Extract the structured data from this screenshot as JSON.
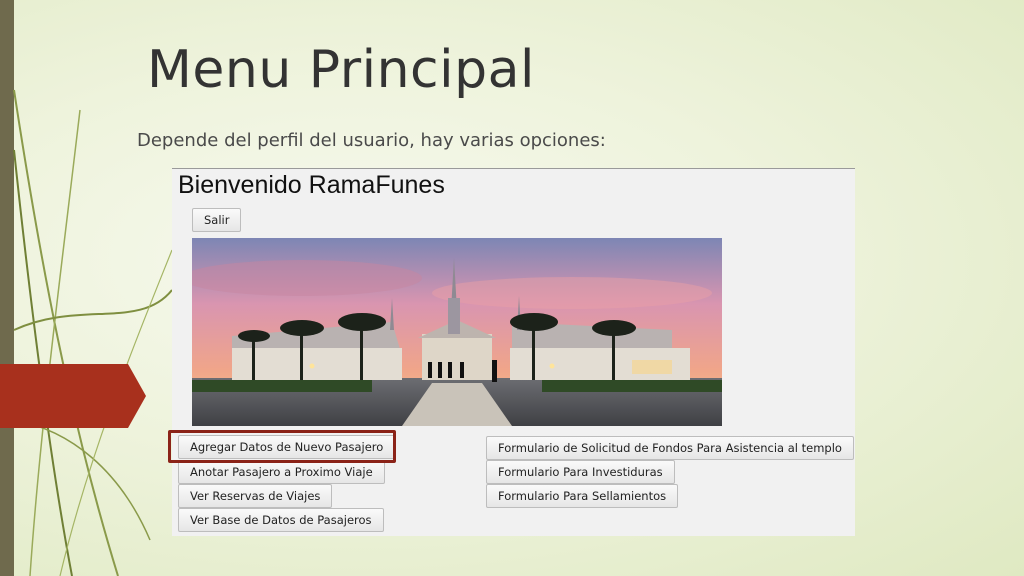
{
  "slide": {
    "title": "Menu Principal",
    "subtitle": "Depende del perfil del usuario, hay varias opciones:"
  },
  "app": {
    "welcome": "Bienvenido RamaFunes",
    "logout_label": "Salir",
    "image_description_icon": "temple-photo",
    "left_column": [
      "Agregar Datos de Nuevo Pasajero",
      "Anotar Pasajero a Proximo Viaje",
      "Ver Reservas de Viajes",
      "Ver Base de Datos de Pasajeros"
    ],
    "right_column": [
      "Formulario de Solicitud de Fondos Para Asistencia al templo",
      "Formulario Para Investiduras",
      "Formulario Para Sellamientos"
    ]
  },
  "colors": {
    "accent_red": "#a8301d",
    "highlight_border": "#8b2318",
    "side_bar": "#6f6a4d",
    "background": "#eef3dc"
  }
}
